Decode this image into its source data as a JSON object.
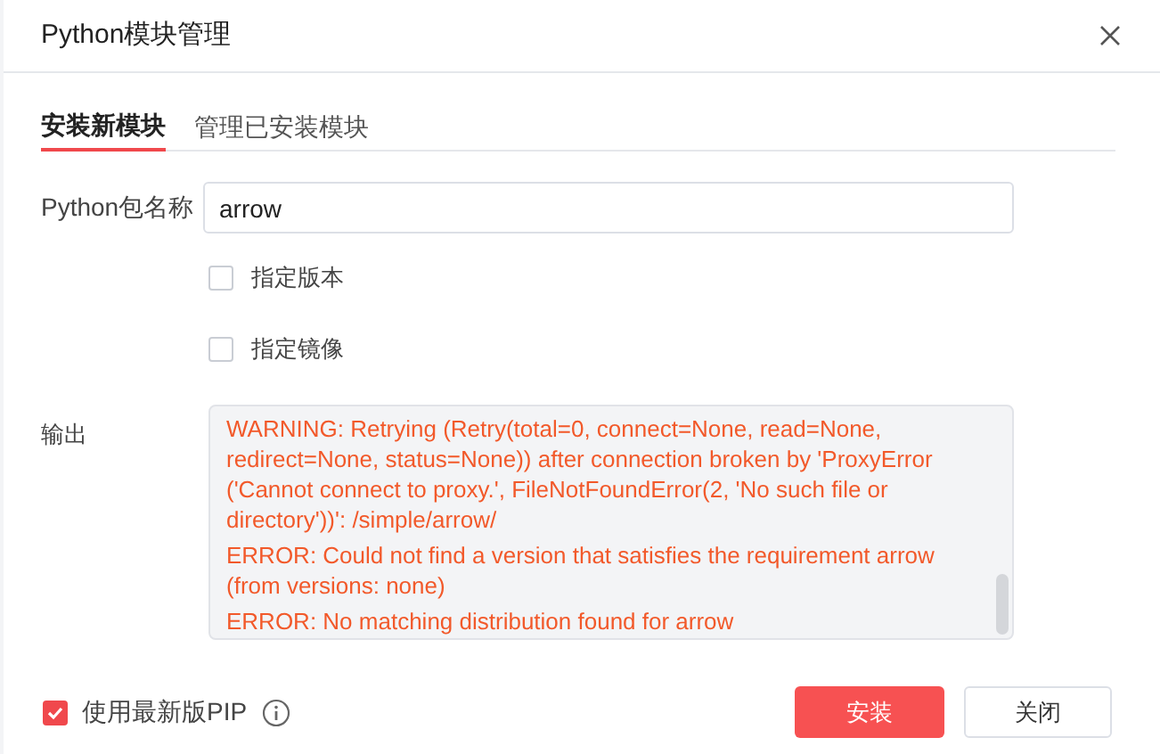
{
  "window": {
    "title": "Python模块管理"
  },
  "tabs": [
    {
      "label": "安装新模块",
      "selected": true
    },
    {
      "label": "管理已安装模块",
      "selected": false
    }
  ],
  "package_field": {
    "label": "Python包名称",
    "value": "arrow"
  },
  "options": [
    {
      "label": "指定版本",
      "checked": false
    },
    {
      "label": "指定镜像",
      "checked": false
    }
  ],
  "output": {
    "label": "输出",
    "lines": [
      "WARNING: Retrying (Retry(total=0, connect=None, read=None, redirect=None, status=None)) after connection broken by 'ProxyError ('Cannot connect to proxy.', FileNotFoundError(2, 'No such file or directory'))': /simple/arrow/",
      "ERROR: Could not find a version that satisfies the requirement arrow (from versions: none)",
      "ERROR: No matching distribution found for arrow"
    ]
  },
  "footer": {
    "latest_pip": {
      "label": "使用最新版PIP",
      "checked": true
    },
    "buttons": [
      {
        "label": "安装",
        "kind": "primary"
      },
      {
        "label": "关闭",
        "kind": "secondary"
      }
    ]
  }
}
